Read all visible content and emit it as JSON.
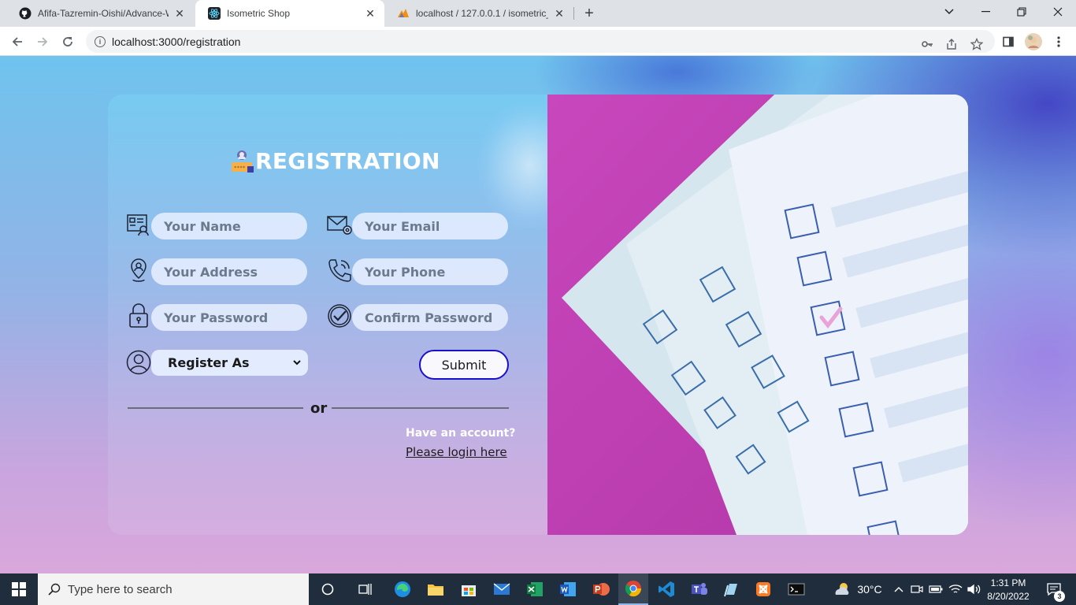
{
  "browser": {
    "tabs": [
      {
        "title": "Afifa-Tazremin-Oishi/Advance-W",
        "icon": "github-icon",
        "active": false
      },
      {
        "title": "Isometric Shop",
        "icon": "react-icon",
        "active": true
      },
      {
        "title": "localhost / 127.0.0.1 / isometric_",
        "icon": "phpmyadmin-icon",
        "active": false
      }
    ],
    "url": "localhost:3000/registration"
  },
  "page": {
    "title": "REGISTRATION",
    "fields": {
      "name_placeholder": "Your Name",
      "email_placeholder": "Your Email",
      "address_placeholder": "Your Address",
      "phone_placeholder": "Your Phone",
      "password_placeholder": "Your Password",
      "confirm_placeholder": "Confirm Password"
    },
    "register_as": "Register As",
    "submit_label": "Submit",
    "divider_text": "or",
    "have_account": "Have an account?",
    "login_link": "Please login here",
    "colors": {
      "submit_border": "#1a12c9",
      "image_bg": "#c23fb5"
    }
  },
  "taskbar": {
    "search_placeholder": "Type here to search",
    "weather": "30°C",
    "time": "1:31 PM",
    "date": "8/20/2022",
    "notification_count": "3"
  }
}
